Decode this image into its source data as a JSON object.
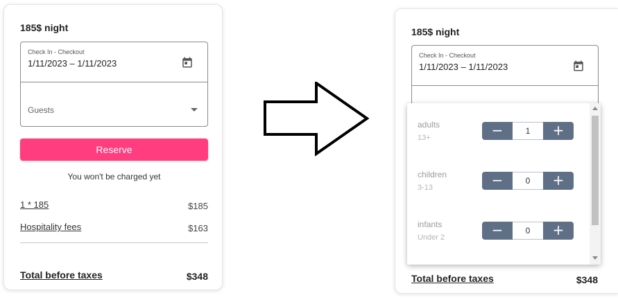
{
  "before": {
    "price": "185$ night",
    "field_label": "Check In - Checkout",
    "dates": "1/11/2023 – 1/11/2023",
    "guests_placeholder": "Guests",
    "reserve_label": "Reserve",
    "note": "You won't be charged yet",
    "lines": [
      {
        "label": "1 * 185",
        "amount": "$185"
      },
      {
        "label": "Hospitality fees",
        "amount": "$163"
      }
    ],
    "total_label": "Total before taxes",
    "total_amount": "$348"
  },
  "after": {
    "price": "185$ night",
    "field_label": "Check In - Checkout",
    "dates": "1/11/2023 – 1/11/2023",
    "guest_rows": [
      {
        "name": "adults",
        "sub": "13+",
        "value": "1"
      },
      {
        "name": "children",
        "sub": "3-13",
        "value": "0"
      },
      {
        "name": "infants",
        "sub": "Under 2",
        "value": "0"
      }
    ],
    "minus": "−",
    "plus": "+",
    "total_label": "Total before taxes",
    "total_amount": "$348"
  },
  "colors": {
    "reserve": "#ff3d7f",
    "stepper": "#5f6f86"
  },
  "icons": [
    "calendar-icon",
    "dropdown-arrow-icon",
    "transition-arrow-icon"
  ]
}
